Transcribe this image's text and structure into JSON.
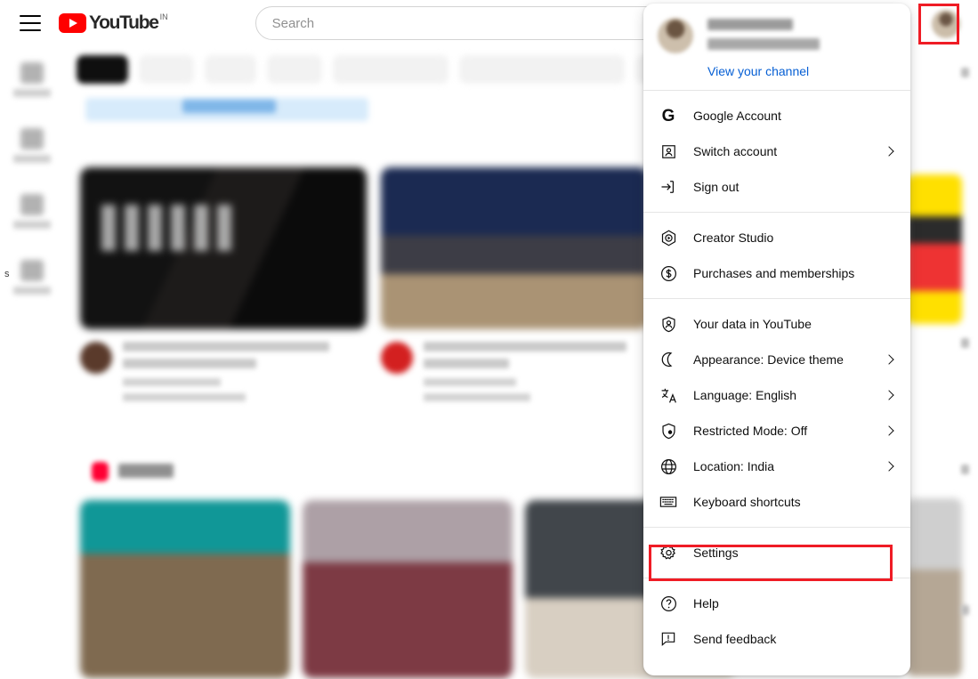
{
  "header": {
    "menu_icon": "hamburger-menu-icon",
    "logo_text": "YouTube",
    "logo_country_code": "IN",
    "search_placeholder": "Search",
    "search_value": "",
    "avatar_label": "Account avatar"
  },
  "sidebar": {
    "items": [
      {
        "label": "",
        "icon": "home-icon"
      },
      {
        "label": "",
        "icon": "shorts-icon"
      },
      {
        "label": "",
        "icon": "subscriptions-icon"
      },
      {
        "label": "",
        "icon": "you-icon"
      }
    ],
    "stray_text": "s"
  },
  "account_menu": {
    "profile": {
      "name": "",
      "handle": "",
      "view_channel_label": "View your channel"
    },
    "groups": [
      {
        "items": [
          {
            "label": "Google Account",
            "icon": "google-g-icon",
            "has_submenu": false
          },
          {
            "label": "Switch account",
            "icon": "switch-account-icon",
            "has_submenu": true
          },
          {
            "label": "Sign out",
            "icon": "sign-out-icon",
            "has_submenu": false
          }
        ]
      },
      {
        "items": [
          {
            "label": "Creator Studio",
            "icon": "creator-studio-icon",
            "has_submenu": false
          },
          {
            "label": "Purchases and memberships",
            "icon": "dollar-circle-icon",
            "has_submenu": false
          }
        ]
      },
      {
        "items": [
          {
            "label": "Your data in YouTube",
            "icon": "shield-person-icon",
            "has_submenu": false
          },
          {
            "label": "Appearance: Device theme",
            "icon": "moon-icon",
            "has_submenu": true
          },
          {
            "label": "Language: English",
            "icon": "translate-icon",
            "has_submenu": true
          },
          {
            "label": "Restricted Mode: Off",
            "icon": "shield-lock-icon",
            "has_submenu": true
          },
          {
            "label": "Location: India",
            "icon": "globe-icon",
            "has_submenu": true
          },
          {
            "label": "Keyboard shortcuts",
            "icon": "keyboard-icon",
            "has_submenu": false
          }
        ]
      },
      {
        "items": [
          {
            "label": "Settings",
            "icon": "gear-icon",
            "has_submenu": false,
            "highlighted": true
          }
        ]
      },
      {
        "items": [
          {
            "label": "Help",
            "icon": "help-circle-icon",
            "has_submenu": false
          },
          {
            "label": "Send feedback",
            "icon": "feedback-icon",
            "has_submenu": false
          }
        ]
      }
    ]
  },
  "highlights": {
    "color": "#ef1c25",
    "targets": [
      "avatar-button",
      "settings-menu-item"
    ]
  },
  "colors": {
    "brand_red": "#ff0000",
    "link_blue": "#065fd4",
    "text_primary": "#0f0f0f",
    "highlight_red": "#ef1c25"
  }
}
